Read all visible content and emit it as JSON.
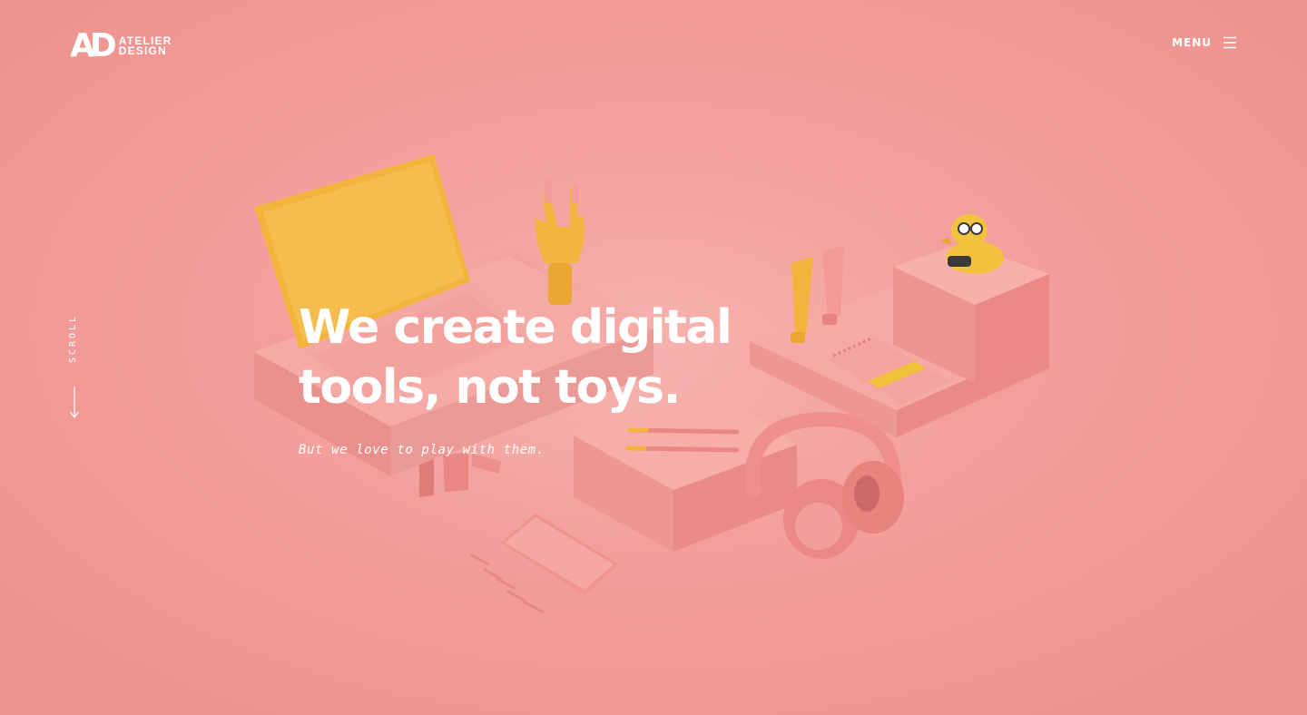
{
  "brand": {
    "monogram": "AD",
    "name_line1": "ATELIER",
    "name_line2": "DESIGN"
  },
  "nav": {
    "menu_label": "MENU",
    "menu_icon": "hamburger-icon"
  },
  "scroll": {
    "label": "SCROLL",
    "icon": "arrow-down-icon"
  },
  "hero": {
    "title_line1": "We create digital",
    "title_line2": "tools, not toys.",
    "subtitle": "But we love to play with them."
  },
  "colors": {
    "background": "#F29E9A",
    "text": "#FFFFFF",
    "accent_yellow": "#F2B43C"
  }
}
